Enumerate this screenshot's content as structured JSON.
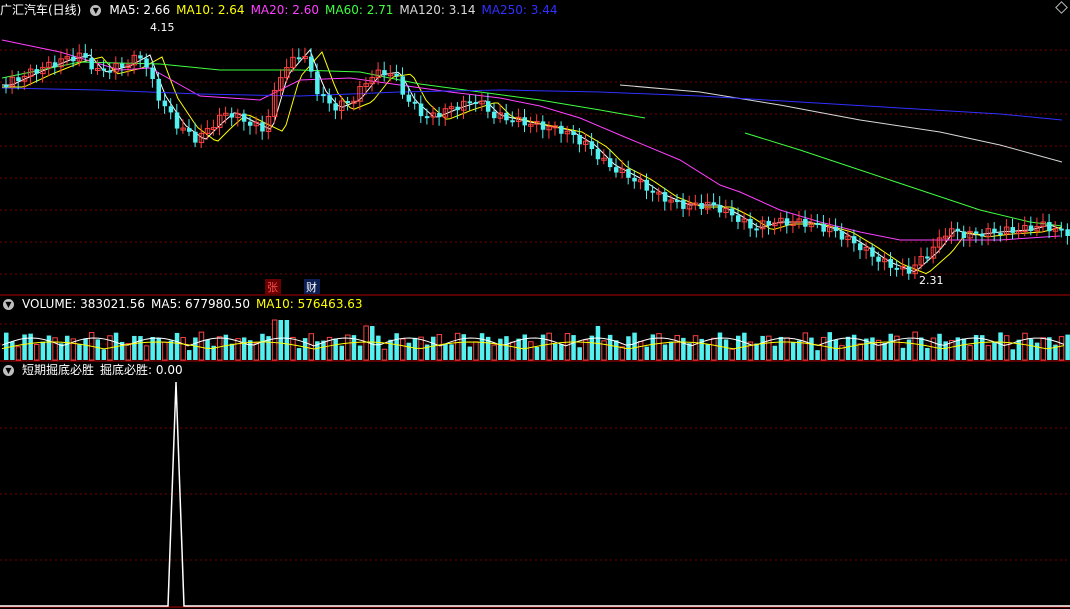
{
  "colors": {
    "bg": "#000000",
    "grid": "#7a0000",
    "divider": "#b00000",
    "up": "#ff4040",
    "down": "#54f0f0",
    "ma5": "#ffffff",
    "ma10": "#ffff00",
    "ma20": "#ff40ff",
    "ma60": "#40ff40",
    "ma120": "#d8d8d8",
    "ma250": "#3030ff",
    "vol_ma5": "#ffffff",
    "vol_ma10": "#ffff00",
    "indicator": "#ffffff"
  },
  "price_panel": {
    "title": "广汇汽车(日线)",
    "settings_icon": "chevron-down-icon",
    "ma": [
      {
        "label": "MA5: 2.66",
        "color": "#ffffff"
      },
      {
        "label": "MA10: 2.64",
        "color": "#ffff00"
      },
      {
        "label": "MA20: 2.60",
        "color": "#ff40ff"
      },
      {
        "label": "MA60: 2.71",
        "color": "#40ff40"
      },
      {
        "label": "MA120: 3.14",
        "color": "#d8d8d8"
      },
      {
        "label": "MA250: 3.44",
        "color": "#3030ff"
      }
    ],
    "high_label": "4.15",
    "low_label": "2.31",
    "badge_zhang": "张",
    "badge_cai": "财"
  },
  "volume_panel": {
    "label": "VOLUME: 383021.56",
    "ma5": "MA5: 677980.50",
    "ma10": "MA10: 576463.63"
  },
  "indicator_panel": {
    "name": "短期掘底必胜",
    "value": "掘底必胜: 0.00"
  }
}
